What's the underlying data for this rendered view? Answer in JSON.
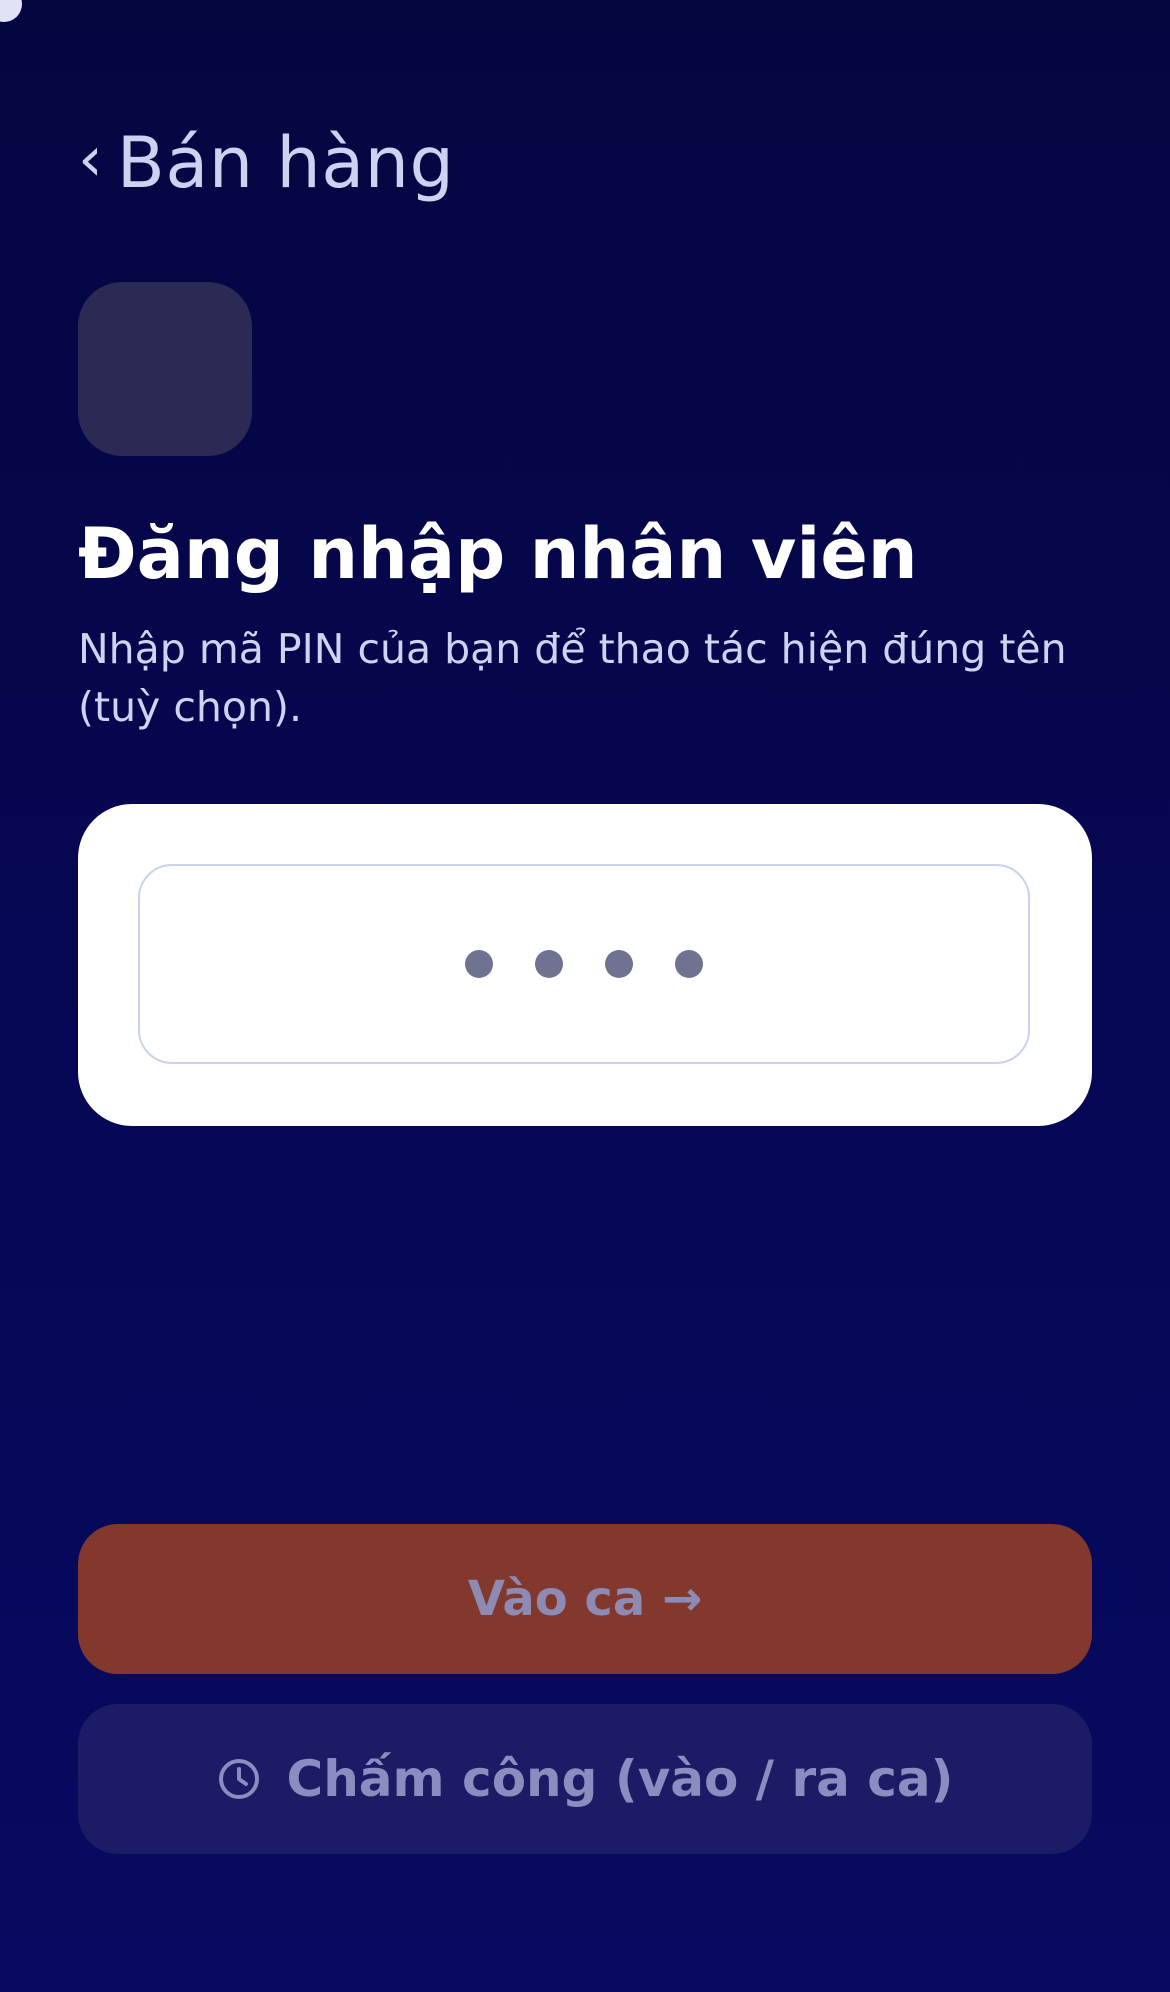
{
  "header": {
    "back_label": "Bán hàng",
    "back_icon": "chevron-left-icon"
  },
  "login": {
    "title": "Đăng nhập nhân viên",
    "subtitle": "Nhập mã PIN của bạn để thao tác hiện đúng tên (tuỳ chọn).",
    "pin_length": 4
  },
  "actions": {
    "start_shift_label": "Vào ca →",
    "timekeeping_label": "Chấm công (vào / ra ca)",
    "timekeeping_icon": "clock-icon"
  },
  "colors": {
    "background": "#050640",
    "primary_button": "#82382d",
    "secondary_button": "#1b1c65",
    "pin_dot": "#6f7290"
  }
}
